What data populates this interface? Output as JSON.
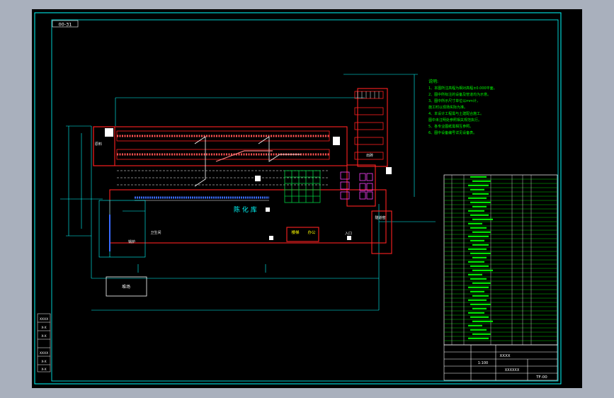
{
  "drawing": {
    "corner_code": "00-31",
    "notes_title": "说明:",
    "notes": [
      "1、本图所注高程为相对高程±0.000平面。",
      "2、图中所标注的设备及管道均为示意。",
      "3、图中所示尺寸单位以mm计，",
      "   施工时以现场实际为准。",
      "4、本设计工程需与土建配合施工。",
      "   图中未注明处参照相关规范执行。",
      "5、各专业图纸需相互参照。",
      "6、图中设备编号详见设备表。"
    ],
    "room_labels": {
      "aging_room": "陈 化 库",
      "yard": "堆场",
      "office": "办公",
      "stair": "楼梯",
      "toilet": "卫生间",
      "boiler": "锅炉",
      "brick_loading": "出砖",
      "entrance": "入口",
      "raw_material": "原料",
      "kiln": "隧道窑"
    },
    "title_block": {
      "project": "XXXX",
      "drawing_name": "XXXXXX",
      "sheet_no": "TF-00",
      "scale": "1:100"
    },
    "left_margin_labels": [
      "XXXX",
      "X-X",
      "X-X",
      "XXXX",
      "X-X",
      "X-X"
    ],
    "colors": {
      "sheet_bg": "#000000",
      "frame": "#00ffff",
      "wall": "#ff2020",
      "note_text": "#00ff00",
      "equipment_green": "#00d040",
      "equipment_magenta": "#ff40ff",
      "conveyor_blue": "#3a6bff",
      "white_line": "#ffffff",
      "yellow": "#ffff00"
    }
  }
}
